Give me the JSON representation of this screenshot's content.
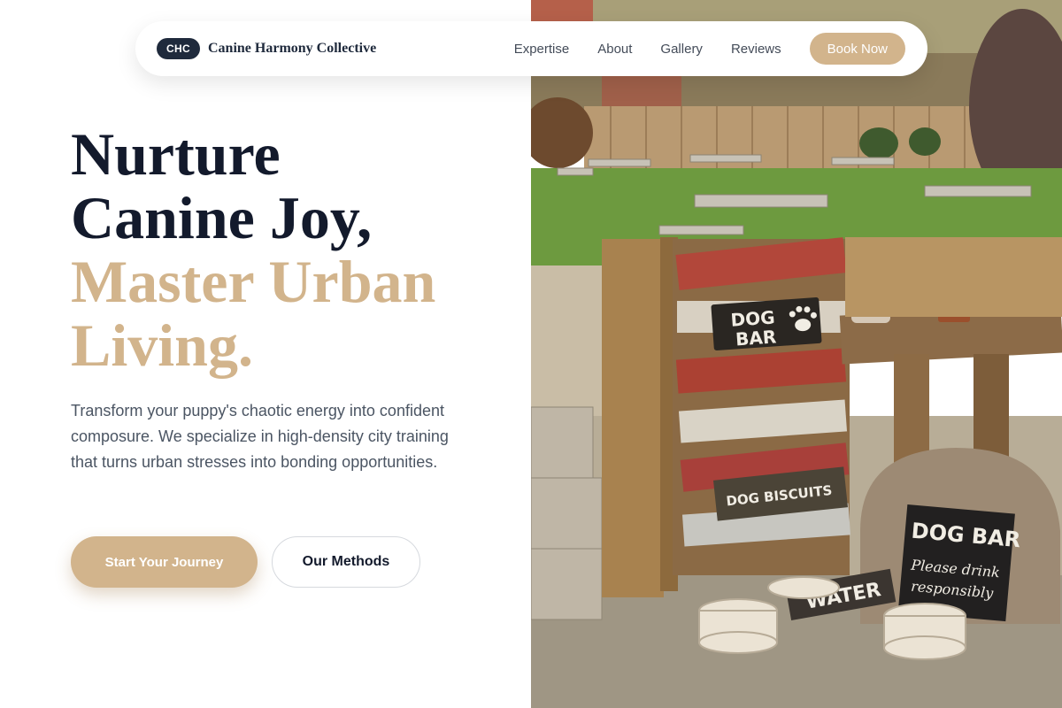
{
  "brand": {
    "badge": "CHC",
    "name": "Canine Harmony Collective"
  },
  "nav": {
    "links": [
      "Expertise",
      "About",
      "Gallery",
      "Reviews"
    ],
    "cta": "Book Now"
  },
  "hero": {
    "title_line1": "Nurture",
    "title_line2": "Canine Joy,",
    "title_line3": "Master Urban",
    "title_line4": "Living.",
    "description": "Transform your puppy's chaotic energy into confident composure. We specialize in high-density city training that turns urban stresses into bonding opportunities.",
    "primary_button": "Start Your Journey",
    "secondary_button": "Our Methods"
  },
  "photo": {
    "sign_dog_bar_line1": "DOG",
    "sign_dog_bar_line2": "BAR",
    "sign_biscuits": "DOG BISCUITS",
    "sign_water": "WATER",
    "board_title": "DOG BAR",
    "board_line1": "Please drink",
    "board_line2": "responsibly"
  },
  "colors": {
    "accent": "#d2b48c",
    "navy": "#1f2a3c",
    "text": "#4b5563"
  }
}
